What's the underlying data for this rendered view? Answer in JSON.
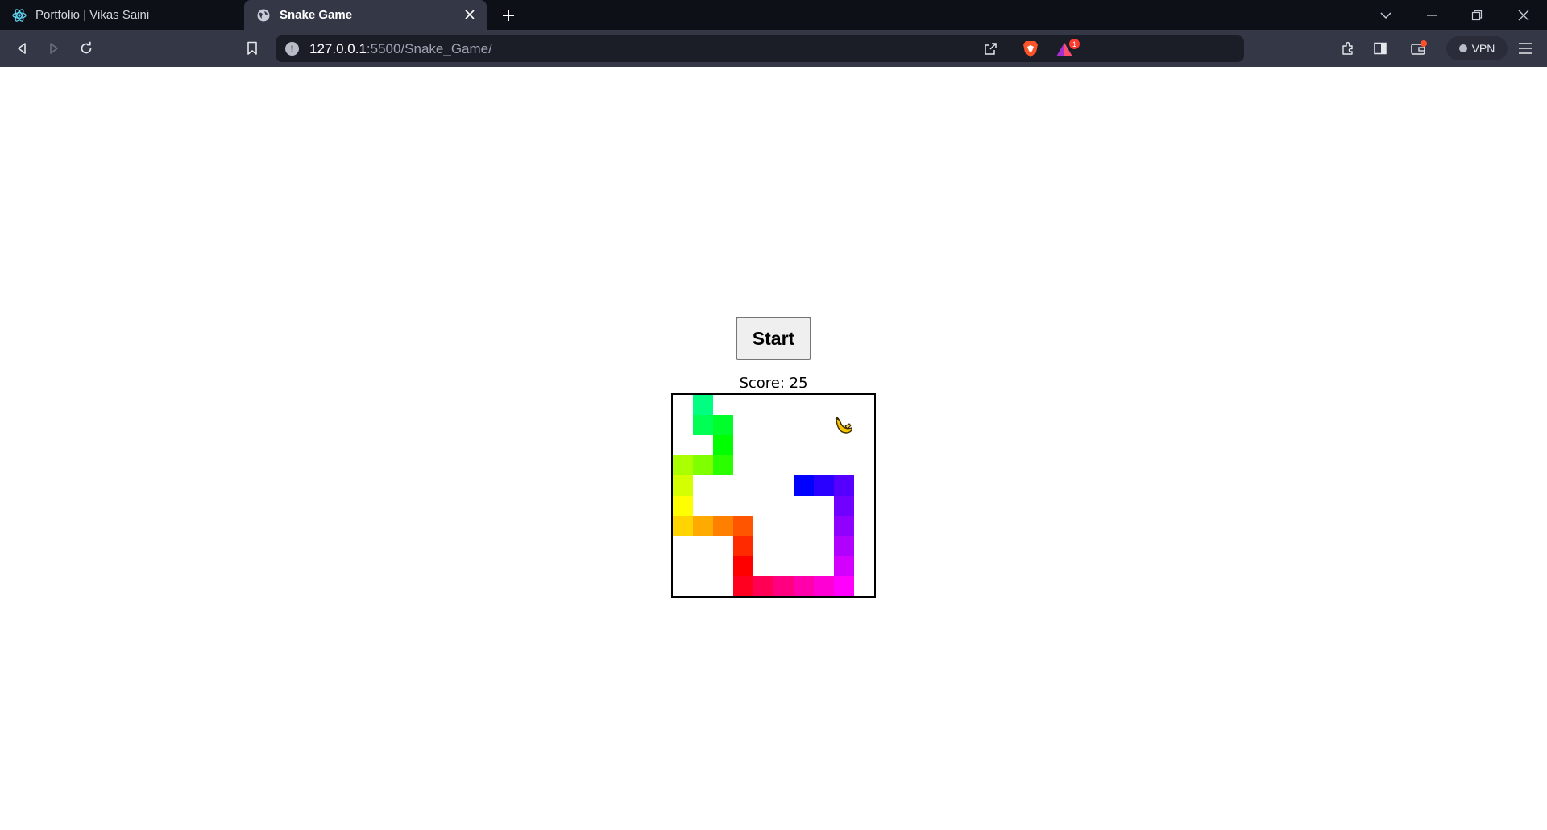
{
  "browser": {
    "tabs": [
      {
        "title": "Portfolio | Vikas Saini",
        "active": false,
        "icon": "react-icon"
      },
      {
        "title": "Snake Game",
        "active": true,
        "icon": "globe-icon"
      }
    ],
    "url": {
      "host": "127.0.0.1",
      "rest": ":5500/Snake_Game/"
    },
    "rewards_badge": "1",
    "vpn_label": "VPN"
  },
  "game": {
    "start_label": "Start",
    "score_label": "Score: 25",
    "grid_size": 10,
    "food": {
      "cell": [
        8,
        1
      ],
      "icon": "banana-icon"
    },
    "snake": [
      {
        "cell": [
          1,
          0
        ],
        "color": "#00ff80"
      },
      {
        "cell": [
          1,
          1
        ],
        "color": "#00ff55"
      },
      {
        "cell": [
          2,
          1
        ],
        "color": "#00ff2a"
      },
      {
        "cell": [
          2,
          2
        ],
        "color": "#00ff00"
      },
      {
        "cell": [
          2,
          3
        ],
        "color": "#2aff00"
      },
      {
        "cell": [
          1,
          3
        ],
        "color": "#80ff00"
      },
      {
        "cell": [
          0,
          3
        ],
        "color": "#aaff00"
      },
      {
        "cell": [
          0,
          4
        ],
        "color": "#d4ff00"
      },
      {
        "cell": [
          0,
          5
        ],
        "color": "#ffff00"
      },
      {
        "cell": [
          0,
          6
        ],
        "color": "#ffd400"
      },
      {
        "cell": [
          1,
          6
        ],
        "color": "#ffaa00"
      },
      {
        "cell": [
          2,
          6
        ],
        "color": "#ff8000"
      },
      {
        "cell": [
          3,
          6
        ],
        "color": "#ff5500"
      },
      {
        "cell": [
          3,
          7
        ],
        "color": "#ff2a00"
      },
      {
        "cell": [
          3,
          8
        ],
        "color": "#ff0000"
      },
      {
        "cell": [
          3,
          9
        ],
        "color": "#ff0020"
      },
      {
        "cell": [
          4,
          9
        ],
        "color": "#ff0055"
      },
      {
        "cell": [
          5,
          9
        ],
        "color": "#ff0080"
      },
      {
        "cell": [
          6,
          9
        ],
        "color": "#ff00aa"
      },
      {
        "cell": [
          7,
          9
        ],
        "color": "#ff00d4"
      },
      {
        "cell": [
          8,
          9
        ],
        "color": "#ff00ff"
      },
      {
        "cell": [
          8,
          8
        ],
        "color": "#d400ff"
      },
      {
        "cell": [
          8,
          7
        ],
        "color": "#b000ff"
      },
      {
        "cell": [
          8,
          6
        ],
        "color": "#9000ff"
      },
      {
        "cell": [
          8,
          5
        ],
        "color": "#7000ff"
      },
      {
        "cell": [
          8,
          4
        ],
        "color": "#5500ff"
      },
      {
        "cell": [
          7,
          4
        ],
        "color": "#2a00ff"
      },
      {
        "cell": [
          6,
          4
        ],
        "color": "#0000ff"
      }
    ]
  }
}
